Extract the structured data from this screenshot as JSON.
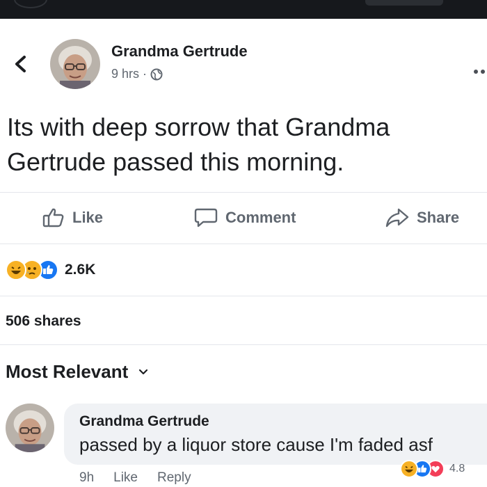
{
  "post": {
    "author": "Grandma Gertrude",
    "time": "9 hrs",
    "separator": "·",
    "privacy_icon": "globe-icon",
    "text": "Its with deep sorrow that Grandma Gertrude passed this morning."
  },
  "actions": {
    "like": "Like",
    "comment": "Comment",
    "share": "Share"
  },
  "reactions": {
    "icons": [
      "haha-icon",
      "sad-icon",
      "like-icon"
    ],
    "count": "2.6K"
  },
  "shares": "506 shares",
  "filter": {
    "label": "Most Relevant"
  },
  "comment": {
    "author": "Grandma Gertrude",
    "text": "passed by a liquor store cause I'm faded asf",
    "time": "9h",
    "like": "Like",
    "reply": "Reply",
    "reaction_icons": [
      "haha-icon",
      "like-icon",
      "love-icon"
    ],
    "reaction_count": "4.8"
  },
  "colors": {
    "text": "#1c1e21",
    "secondary": "#606770",
    "like_blue": "#1877f2",
    "love_red": "#f33e58",
    "haha_yellow": "#f7b125",
    "bubble": "#f0f2f5"
  }
}
